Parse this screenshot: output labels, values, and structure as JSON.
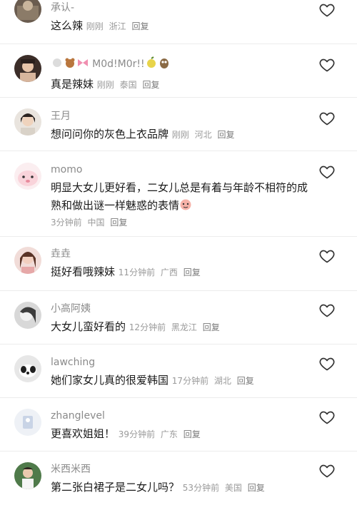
{
  "comments": [
    {
      "name": "承认-",
      "text": "这么辣",
      "time": "刚刚",
      "location": "浙江",
      "reply": "回复"
    },
    {
      "name": "M0d!M0r!!",
      "text": "真是辣妹",
      "time": "刚刚",
      "location": "泰国",
      "reply": "回复"
    },
    {
      "name": "王月",
      "text": "想问问你的灰色上衣品牌",
      "time": "刚刚",
      "location": "河北",
      "reply": "回复"
    },
    {
      "name": "momo",
      "text": "明显大女儿更好看，二女儿总是有着与年龄不相符的成熟和做出谜一样魅惑的表情",
      "time": "3分钟前",
      "location": "中国",
      "reply": "回复"
    },
    {
      "name": "垚垚",
      "text": "挺好看哦辣妹",
      "time": "11分钟前",
      "location": "广西",
      "reply": "回复"
    },
    {
      "name": "小高阿姨",
      "text": "大女儿蛮好看的",
      "time": "12分钟前",
      "location": "黑龙江",
      "reply": "回复"
    },
    {
      "name": "lawching",
      "text": "她们家女儿真的很爱韩国",
      "time": "17分钟前",
      "location": "湖北",
      "reply": "回复"
    },
    {
      "name": "zhanglevel",
      "text": "更喜欢姐姐！",
      "time": "39分钟前",
      "location": "广东",
      "reply": "回复"
    },
    {
      "name": "米西米西",
      "text": "第二张白裙子是二女儿吗？",
      "time": "53分钟前",
      "location": "美国",
      "reply": "回复"
    }
  ],
  "icons": {
    "like": "heart-outline-icon"
  }
}
